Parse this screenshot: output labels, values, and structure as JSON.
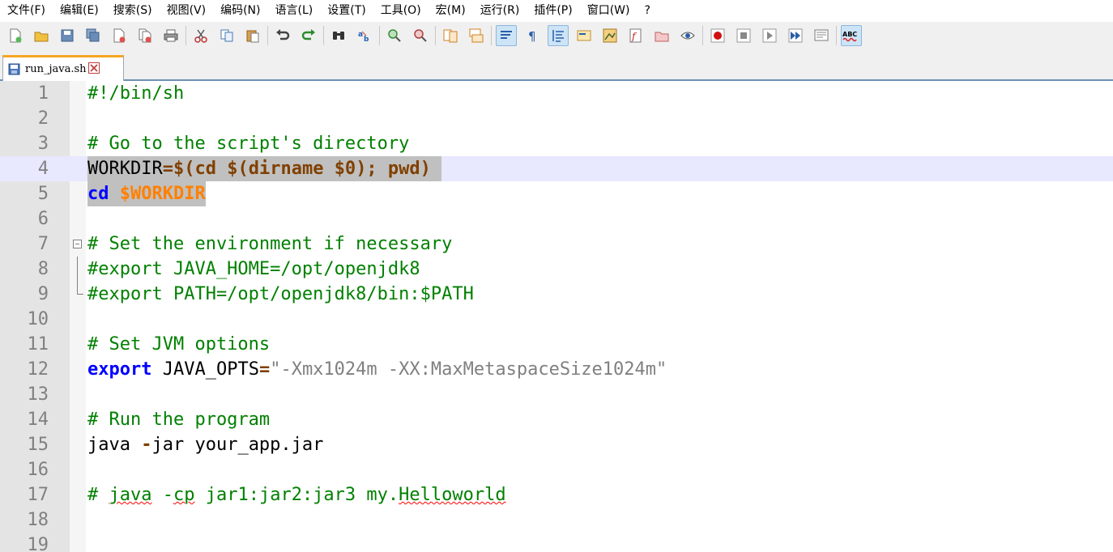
{
  "menu": [
    "文件(F)",
    "编辑(E)",
    "搜索(S)",
    "视图(V)",
    "编码(N)",
    "语言(L)",
    "设置(T)",
    "工具(O)",
    "宏(M)",
    "运行(R)",
    "插件(P)",
    "窗口(W)",
    "?"
  ],
  "toolbar": {
    "spellcheck_label": "ABC"
  },
  "tab": {
    "filename": "run_java.sh"
  },
  "lines": [
    {
      "n": "1"
    },
    {
      "n": "2"
    },
    {
      "n": "3"
    },
    {
      "n": "4"
    },
    {
      "n": "5"
    },
    {
      "n": "6"
    },
    {
      "n": "7"
    },
    {
      "n": "8"
    },
    {
      "n": "9"
    },
    {
      "n": "10"
    },
    {
      "n": "11"
    },
    {
      "n": "12"
    },
    {
      "n": "13"
    },
    {
      "n": "14"
    },
    {
      "n": "15"
    },
    {
      "n": "16"
    },
    {
      "n": "17"
    },
    {
      "n": "18"
    },
    {
      "n": "19"
    }
  ],
  "code": {
    "l1": "#!/bin/sh",
    "l3": "# Go to the script's directory",
    "l4_var": "WORKDIR",
    "l4_op": "=$(",
    "l4_cmd": "cd ",
    "l4_op2": "$(",
    "l4_dirname": "dirname ",
    "l4_arg": "$0",
    "l4_rest": "); pwd)",
    "l5_kw": "cd",
    "l5_var": "$WORKDIR",
    "l7": "# Set the environment if necessary",
    "l8": "#export JAVA_HOME=/opt/openjdk8",
    "l9": "#export PATH=/opt/openjdk8/bin:$PATH",
    "l11": "# Set JVM options",
    "l12_kw": "export",
    "l12_var": "JAVA_OPTS",
    "l12_op": "=",
    "l12_str": "\"-Xmx1024m -XX:MaxMetaspaceSize1024m\"",
    "l14": "# Run the program",
    "l15_a": "java ",
    "l15_op": "-",
    "l15_b": "jar your_app.jar",
    "l17_a": "# ",
    "l17_java": "java",
    "l17_b": " -",
    "l17_cp": "cp",
    "l17_c": " jar1:jar2:jar3 my.",
    "l17_hw": "Helloworld"
  },
  "colors": {
    "comment": "#008000",
    "keyword": "#0000ff",
    "operator": "#804000",
    "variable": "#ff8000",
    "string": "#808080",
    "current_line": "#e8e8ff",
    "selection": "#c0c0c0",
    "tab_accent": "#f5a623"
  }
}
